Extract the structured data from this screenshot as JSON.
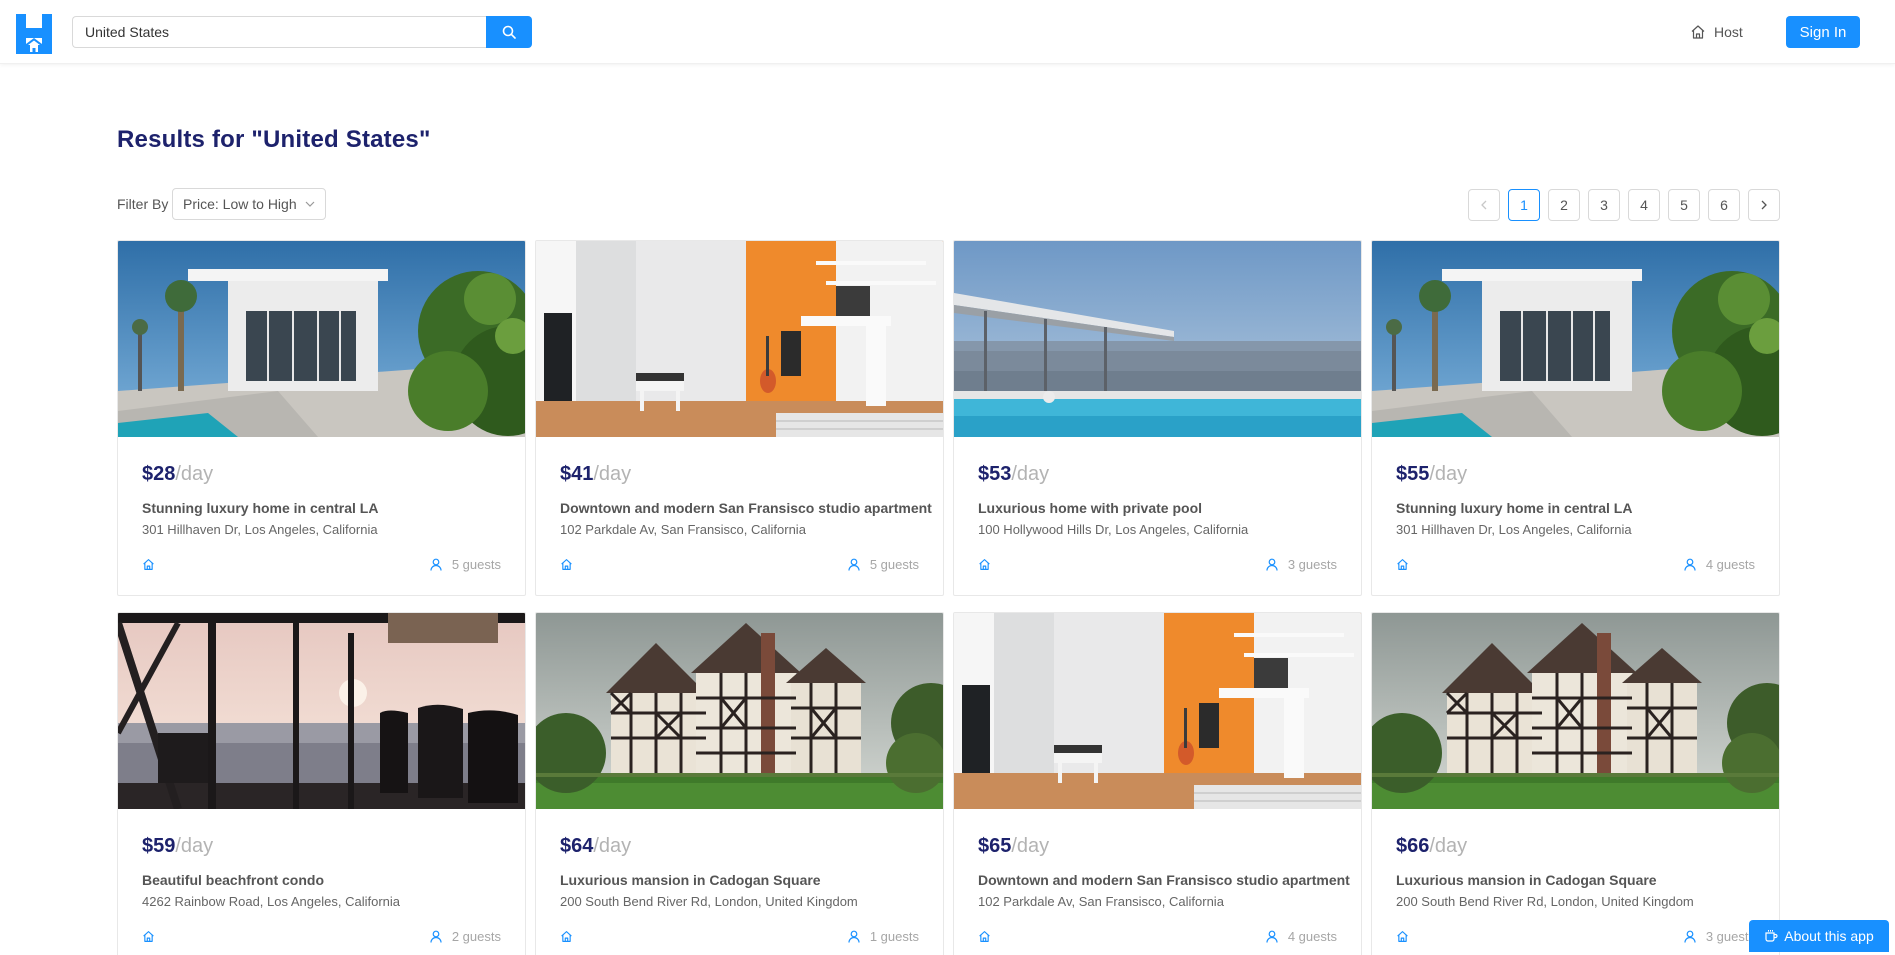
{
  "header": {
    "search_value": "United States",
    "host_label": "Host",
    "signin_label": "Sign In"
  },
  "results": {
    "title": "Results for \"United States\""
  },
  "filter": {
    "label": "Filter By",
    "selected": "Price: Low to High"
  },
  "pagination": {
    "pages": [
      "1",
      "2",
      "3",
      "4",
      "5",
      "6"
    ],
    "current": "1"
  },
  "listings": [
    {
      "price": "$28",
      "unit": "/day",
      "title": "Stunning luxury home in central LA",
      "address": "301 Hillhaven Dr, Los Angeles, California",
      "guests": "5 guests",
      "image": "modern-house-pool"
    },
    {
      "price": "$41",
      "unit": "/day",
      "title": "Downtown and modern San Fransisco studio apartment",
      "address": "102 Parkdale Av, San Fransisco, California",
      "guests": "5 guests",
      "image": "studio-orange-wall"
    },
    {
      "price": "$53",
      "unit": "/day",
      "title": "Luxurious home with private pool",
      "address": "100 Hollywood Hills Dr, Los Angeles, California",
      "guests": "3 guests",
      "image": "pool-city-view"
    },
    {
      "price": "$55",
      "unit": "/day",
      "title": "Stunning luxury home in central LA",
      "address": "301 Hillhaven Dr, Los Angeles, California",
      "guests": "4 guests",
      "image": "modern-house-pool"
    },
    {
      "price": "$59",
      "unit": "/day",
      "title": "Beautiful beachfront condo",
      "address": "4262 Rainbow Road, Los Angeles, California",
      "guests": "2 guests",
      "image": "beach-condo-sunset"
    },
    {
      "price": "$64",
      "unit": "/day",
      "title": "Luxurious mansion in Cadogan Square",
      "address": "200 South Bend River Rd, London, United Kingdom",
      "guests": "1 guests",
      "image": "tudor-mansion"
    },
    {
      "price": "$65",
      "unit": "/day",
      "title": "Downtown and modern San Fransisco studio apartment",
      "address": "102 Parkdale Av, San Fransisco, California",
      "guests": "4 guests",
      "image": "studio-orange-wall"
    },
    {
      "price": "$66",
      "unit": "/day",
      "title": "Luxurious mansion in Cadogan Square",
      "address": "200 South Bend River Rd, London, United Kingdom",
      "guests": "3 guests",
      "image": "tudor-mansion"
    }
  ],
  "about_label": "About this app",
  "colors": {
    "accent": "#1890ff",
    "title": "#1d226c"
  }
}
